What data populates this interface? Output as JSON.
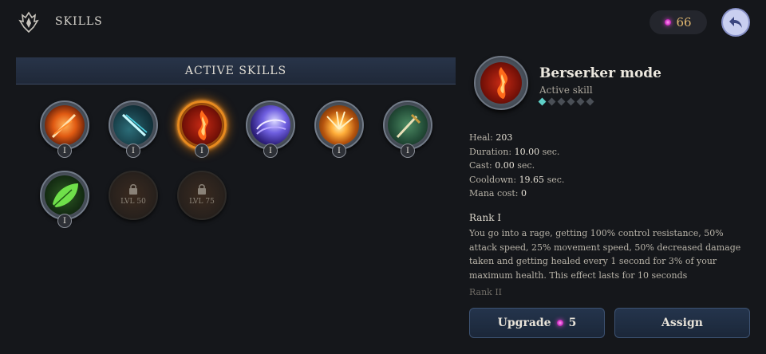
{
  "header": {
    "title": "SKILLS",
    "currency_value": "66"
  },
  "left_panel": {
    "section_title": "ACTIVE SKILLS",
    "skills": [
      {
        "name": "fire-slash",
        "rank": "I",
        "selected": false,
        "locked": false
      },
      {
        "name": "ice-streak",
        "rank": "I",
        "selected": false,
        "locked": false
      },
      {
        "name": "berserker-mode",
        "rank": "I",
        "selected": true,
        "locked": false
      },
      {
        "name": "arcane-vortex",
        "rank": "I",
        "selected": false,
        "locked": false
      },
      {
        "name": "ground-explosion",
        "rank": "I",
        "selected": false,
        "locked": false
      },
      {
        "name": "sword-strike",
        "rank": "I",
        "selected": false,
        "locked": false
      },
      {
        "name": "nature-leaf",
        "rank": "I",
        "selected": false,
        "locked": false
      },
      {
        "name": "locked-skill-50",
        "level_text": "LVL 50",
        "locked": true
      },
      {
        "name": "locked-skill-75",
        "level_text": "LVL 75",
        "locked": true
      }
    ]
  },
  "detail": {
    "name": "Berserker mode",
    "type": "Active skill",
    "rank_progress": {
      "current": 1,
      "max": 6
    },
    "stats": [
      {
        "label": "Heal:",
        "value": "203"
      },
      {
        "label": "Duration:",
        "value": "10.00",
        "unit": "sec."
      },
      {
        "label": "Cast:",
        "value": "0.00",
        "unit": "sec."
      },
      {
        "label": "Cooldown:",
        "value": "19.65",
        "unit": "sec."
      },
      {
        "label": "Mana cost:",
        "value": "0"
      }
    ],
    "rank_title": "Rank I",
    "description": "You go into a rage, getting 100% control resistance, 50% attack speed, 25% movement speed, 50% decreased damage taken and getting healed every 1 second for 3% of your maximum health. This effect lasts for 10 seconds",
    "next_rank": "Rank II",
    "upgrade_label": "Upgrade",
    "upgrade_cost": "5",
    "assign_label": "Assign"
  }
}
